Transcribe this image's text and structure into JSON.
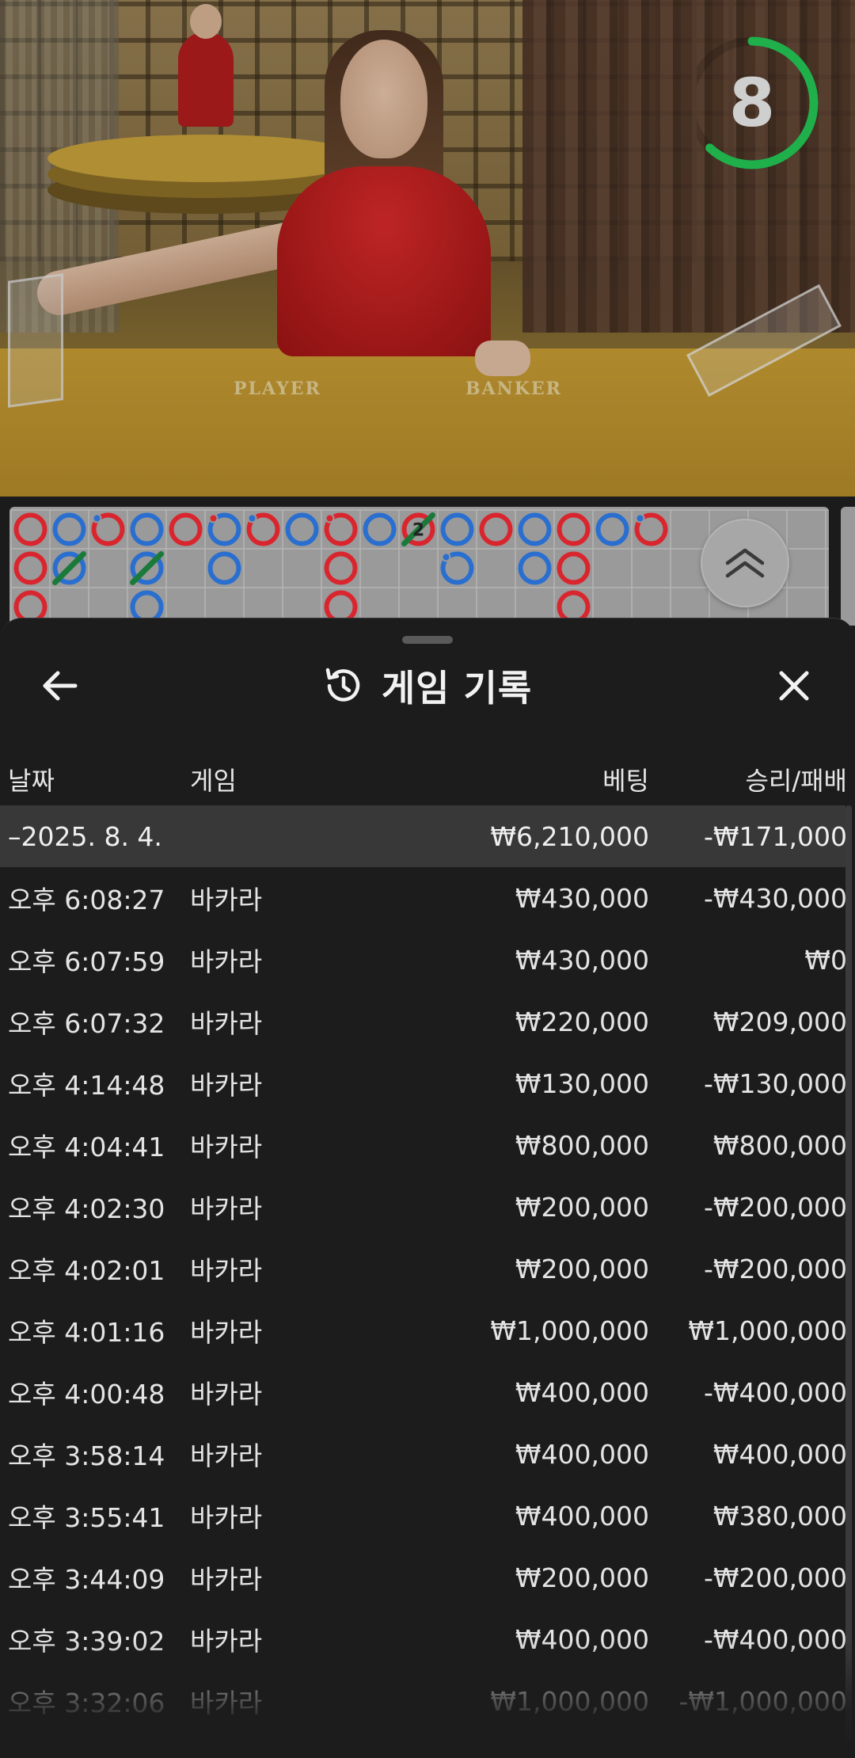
{
  "timer": {
    "seconds": "8",
    "fraction_remaining": 0.62,
    "color": "#1fb04b"
  },
  "video": {
    "table_labels": {
      "player": "PLAYER",
      "banker": "BANKER"
    }
  },
  "roadmap": {
    "colors": {
      "banker": "#d9262e",
      "player": "#2a6fcf",
      "tie": "#1a7a3a"
    },
    "columns": [
      [
        {
          "s": "banker"
        },
        {
          "s": "banker"
        },
        {
          "s": "banker"
        }
      ],
      [
        {
          "s": "player"
        },
        {
          "s": "player",
          "tie": true
        }
      ],
      [
        {
          "s": "banker",
          "dot": "player"
        }
      ],
      [
        {
          "s": "player"
        },
        {
          "s": "player",
          "tie": true
        },
        {
          "s": "player"
        }
      ],
      [
        {
          "s": "banker"
        }
      ],
      [
        {
          "s": "player",
          "dot": "banker"
        },
        {
          "s": "player"
        }
      ],
      [
        {
          "s": "banker",
          "dot": "player"
        }
      ],
      [
        {
          "s": "player"
        }
      ],
      [
        {
          "s": "banker",
          "dot": "banker"
        },
        {
          "s": "banker"
        },
        {
          "s": "banker"
        }
      ],
      [
        {
          "s": "player"
        }
      ],
      [
        {
          "s": "banker",
          "tie": true,
          "tie_count": "2"
        }
      ],
      [
        {
          "s": "player"
        },
        {
          "s": "player",
          "dot": "player"
        }
      ],
      [
        {
          "s": "banker"
        }
      ],
      [
        {
          "s": "player"
        },
        {
          "s": "player"
        }
      ],
      [
        {
          "s": "banker"
        },
        {
          "s": "banker"
        },
        {
          "s": "banker"
        }
      ],
      [
        {
          "s": "player"
        }
      ],
      [
        {
          "s": "banker",
          "dot": "player"
        }
      ]
    ]
  },
  "sheet": {
    "title": "게임 기록",
    "columns": {
      "date": "날짜",
      "game": "게임",
      "bet": "베팅",
      "result": "승리/패배"
    },
    "summary": {
      "date": "–2025. 8. 4.",
      "bet": "₩6,210,000",
      "result": "-₩171,000"
    },
    "rows": [
      {
        "time": "오후 6:08:27",
        "game": "바카라",
        "bet": "₩430,000",
        "result": "-₩430,000"
      },
      {
        "time": "오후 6:07:59",
        "game": "바카라",
        "bet": "₩430,000",
        "result": "₩0"
      },
      {
        "time": "오후 6:07:32",
        "game": "바카라",
        "bet": "₩220,000",
        "result": "₩209,000"
      },
      {
        "time": "오후 4:14:48",
        "game": "바카라",
        "bet": "₩130,000",
        "result": "-₩130,000"
      },
      {
        "time": "오후 4:04:41",
        "game": "바카라",
        "bet": "₩800,000",
        "result": "₩800,000"
      },
      {
        "time": "오후 4:02:30",
        "game": "바카라",
        "bet": "₩200,000",
        "result": "-₩200,000"
      },
      {
        "time": "오후 4:02:01",
        "game": "바카라",
        "bet": "₩200,000",
        "result": "-₩200,000"
      },
      {
        "time": "오후 4:01:16",
        "game": "바카라",
        "bet": "₩1,000,000",
        "result": "₩1,000,000"
      },
      {
        "time": "오후 4:00:48",
        "game": "바카라",
        "bet": "₩400,000",
        "result": "-₩400,000"
      },
      {
        "time": "오후 3:58:14",
        "game": "바카라",
        "bet": "₩400,000",
        "result": "₩400,000"
      },
      {
        "time": "오후 3:55:41",
        "game": "바카라",
        "bet": "₩400,000",
        "result": "₩380,000"
      },
      {
        "time": "오후 3:44:09",
        "game": "바카라",
        "bet": "₩200,000",
        "result": "-₩200,000"
      },
      {
        "time": "오후 3:39:02",
        "game": "바카라",
        "bet": "₩400,000",
        "result": "-₩400,000"
      },
      {
        "time": "오후 3:32:06",
        "game": "바카라",
        "bet": "₩1,000,000",
        "result": "-₩1,000,000"
      }
    ]
  }
}
